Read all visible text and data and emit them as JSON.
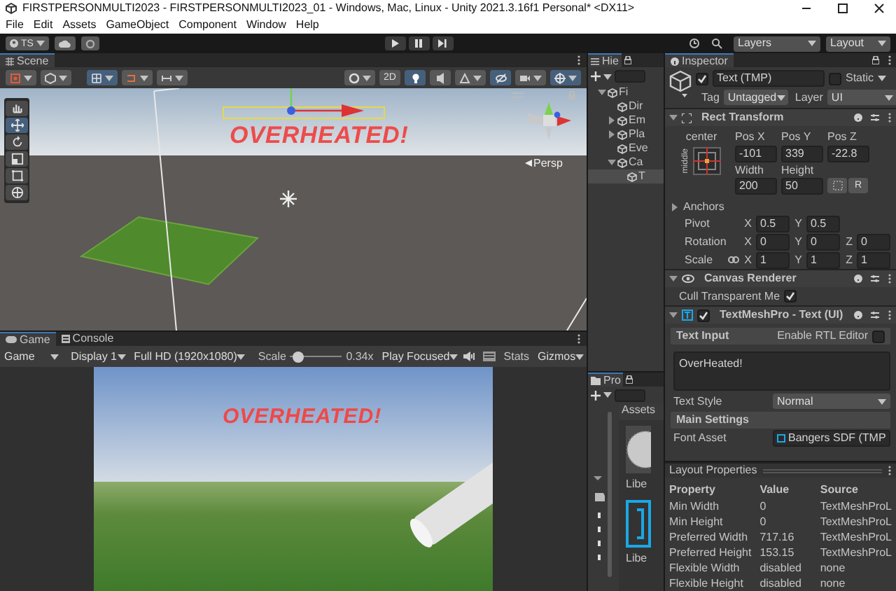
{
  "window": {
    "title": "FIRSTPERSONMULTI2023 - FIRSTPERSONMULTI2023_01 - Windows, Mac, Linux - Unity 2021.3.16f1 Personal* <DX11>"
  },
  "menu": [
    "File",
    "Edit",
    "Assets",
    "GameObject",
    "Component",
    "Window",
    "Help"
  ],
  "toolbar": {
    "account": "TS",
    "layers": "Layers",
    "layout": "Layout"
  },
  "scene": {
    "tab": "Scene",
    "toolbar_left": [
      {
        "selected": false
      },
      {
        "selected": false
      },
      {
        "selected": true
      },
      {
        "selected": false
      },
      {
        "selected": false
      }
    ],
    "toolbar_right": [
      {
        "kind": "icon",
        "selected": false
      },
      {
        "kind": "text",
        "label": "2D",
        "selected": false
      },
      {
        "kind": "icon",
        "selected": true
      },
      {
        "kind": "icon",
        "selected": false
      },
      {
        "kind": "icon",
        "selected": false
      },
      {
        "kind": "icon",
        "selected": true
      },
      {
        "kind": "icon",
        "selected": false
      },
      {
        "kind": "icon",
        "selected": true
      }
    ],
    "tools": [
      {
        "selected": false
      },
      {
        "selected": true
      },
      {
        "selected": false
      },
      {
        "selected": false
      },
      {
        "selected": false
      },
      {
        "selected": false
      }
    ],
    "overlay_text": "OVERHEATED!",
    "persp": "Persp"
  },
  "game": {
    "tabs": [
      {
        "label": "Game",
        "selected": true
      },
      {
        "label": "Console",
        "selected": false
      }
    ],
    "view": "Game",
    "display": "Display 1",
    "resolution": "Full HD (1920x1080)",
    "scale_label": "Scale",
    "scale": {
      "level": 0.04
    },
    "scale_value": "0.34x",
    "play_mode": "Play Focused",
    "stats": "Stats",
    "gizmos": "Gizmos",
    "overlay_text": "OVERHEATED!"
  },
  "hierarchy": {
    "tab": "Hie",
    "items": [
      {
        "label": "Fi",
        "expanded": true,
        "selected": false,
        "children": [
          {
            "label": "Dir",
            "selected": false
          },
          {
            "label": "Em",
            "expanded": false,
            "selected": false
          },
          {
            "label": "Pla",
            "expanded": false,
            "selected": false
          },
          {
            "label": "Eve",
            "selected": false
          },
          {
            "label": "Ca",
            "expanded": true,
            "selected": false,
            "children": [
              {
                "label": "T",
                "selected": true
              }
            ]
          }
        ]
      }
    ]
  },
  "project": {
    "tab": "Pro",
    "breadcrumb": "Assets",
    "assets": [
      {
        "label": "Libe",
        "kind": "texture"
      },
      {
        "label": "Libe",
        "kind": "font"
      }
    ]
  },
  "inspector": {
    "tab": "Inspector",
    "object": {
      "active": true,
      "name": "Text (TMP)",
      "static": false,
      "static_label": "Static",
      "tag_label": "Tag",
      "tag": "Untagged",
      "layer_label": "Layer",
      "layer": "UI"
    },
    "rect_transform": {
      "title": "Rect Transform",
      "expanded": true,
      "anchor_h": "center",
      "anchor_v": "middle",
      "fields": [
        {
          "label": "Pos X",
          "value": "-101"
        },
        {
          "label": "Pos Y",
          "value": "339"
        },
        {
          "label": "Pos Z",
          "value": "-22.8"
        },
        {
          "label": "Width",
          "value": "200"
        },
        {
          "label": "Height",
          "value": "50"
        }
      ],
      "raw_label": "R",
      "anchors": {
        "label": "Anchors",
        "expanded": false
      },
      "vectors": [
        {
          "label": "Pivot",
          "axes": [
            {
              "axis": "X",
              "value": "0.5"
            },
            {
              "axis": "Y",
              "value": "0.5"
            }
          ]
        },
        {
          "label": "Rotation",
          "axes": [
            {
              "axis": "X",
              "value": "0"
            },
            {
              "axis": "Y",
              "value": "0"
            },
            {
              "axis": "Z",
              "value": "0"
            }
          ]
        },
        {
          "label": "Scale",
          "linked": true,
          "axes": [
            {
              "axis": "X",
              "value": "1"
            },
            {
              "axis": "Y",
              "value": "1"
            },
            {
              "axis": "Z",
              "value": "1"
            }
          ]
        }
      ]
    },
    "canvas_renderer": {
      "title": "Canvas Renderer",
      "expanded": true,
      "cull_label": "Cull Transparent Me",
      "cull": true
    },
    "textmeshpro": {
      "title": "TextMeshPro - Text (UI)",
      "expanded": true,
      "enabled": true,
      "text_input_label": "Text Input",
      "rtl_label": "Enable RTL Editor",
      "rtl": false,
      "text": "OverHeated!",
      "text_style_label": "Text Style",
      "text_style": "Normal",
      "main_settings": "Main Settings",
      "font_asset_label": "Font Asset",
      "font_asset": "Bangers SDF (TMP"
    }
  },
  "layout_properties": {
    "title": "Layout Properties",
    "columns": [
      "Property",
      "Value",
      "Source"
    ],
    "rows": [
      [
        "Min Width",
        "0",
        "TextMeshProL"
      ],
      [
        "Min Height",
        "0",
        "TextMeshProL"
      ],
      [
        "Preferred Width",
        "717.16",
        "TextMeshProL"
      ],
      [
        "Preferred Height",
        "153.15",
        "TextMeshProL"
      ],
      [
        "Flexible Width",
        "disabled",
        "none"
      ],
      [
        "Flexible Height",
        "disabled",
        "none"
      ]
    ]
  }
}
